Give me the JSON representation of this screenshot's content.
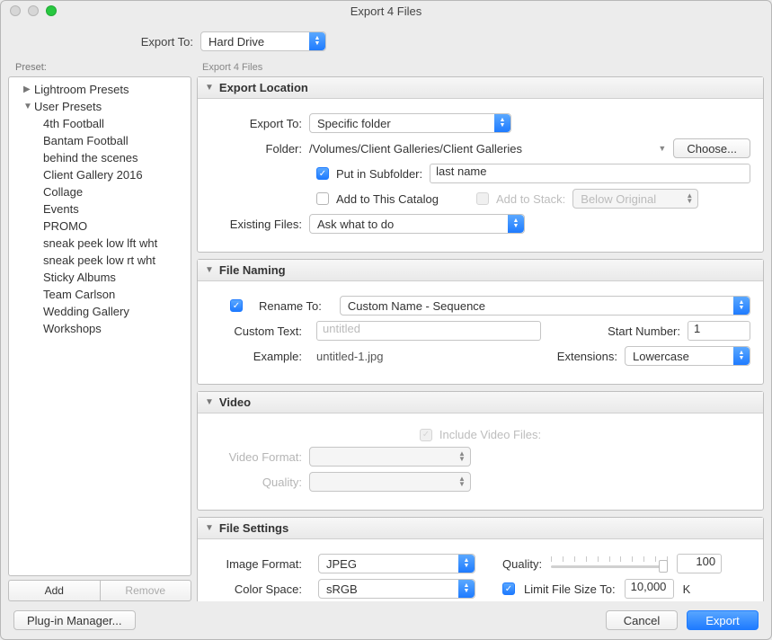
{
  "window": {
    "title": "Export 4 Files"
  },
  "export_to": {
    "label": "Export To:",
    "value": "Hard Drive"
  },
  "sidebar": {
    "header": "Preset:",
    "groups": [
      {
        "name": "Lightroom Presets",
        "expanded": false
      },
      {
        "name": "User Presets",
        "expanded": true
      }
    ],
    "user_presets": [
      "4th Football",
      "Bantam Football",
      "behind the scenes",
      "Client Gallery 2016",
      "Collage",
      "Events",
      "PROMO",
      "sneak peek low lft wht",
      "sneak peek low rt wht",
      "Sticky Albums",
      "Team Carlson",
      "Wedding Gallery",
      "Workshops"
    ],
    "add": "Add",
    "remove": "Remove"
  },
  "right_header": "Export 4 Files",
  "export_location": {
    "title": "Export Location",
    "export_to_label": "Export To:",
    "export_to_value": "Specific folder",
    "folder_label": "Folder:",
    "folder_path": "/Volumes/Client Galleries/Client Galleries",
    "choose": "Choose...",
    "put_subfolder_label": "Put in Subfolder:",
    "put_subfolder_checked": true,
    "subfolder_value": "last name",
    "add_catalog_label": "Add to This Catalog",
    "add_catalog_checked": false,
    "add_stack_label": "Add to Stack:",
    "stack_value": "Below Original",
    "existing_label": "Existing Files:",
    "existing_value": "Ask what to do"
  },
  "file_naming": {
    "title": "File Naming",
    "rename_label": "Rename To:",
    "rename_checked": true,
    "rename_value": "Custom Name - Sequence",
    "custom_text_label": "Custom Text:",
    "custom_text_placeholder": "untitled",
    "start_number_label": "Start Number:",
    "start_number_value": "1",
    "example_label": "Example:",
    "example_value": "untitled-1.jpg",
    "extensions_label": "Extensions:",
    "extensions_value": "Lowercase"
  },
  "video": {
    "title": "Video",
    "include_label": "Include Video Files:",
    "format_label": "Video Format:",
    "quality_label": "Quality:"
  },
  "file_settings": {
    "title": "File Settings",
    "image_format_label": "Image Format:",
    "image_format_value": "JPEG",
    "quality_label": "Quality:",
    "quality_value": "100",
    "color_space_label": "Color Space:",
    "color_space_value": "sRGB",
    "limit_label": "Limit File Size To:",
    "limit_checked": true,
    "limit_value": "10,000",
    "limit_unit": "K"
  },
  "footer": {
    "plugin_manager": "Plug-in Manager...",
    "cancel": "Cancel",
    "export": "Export"
  }
}
